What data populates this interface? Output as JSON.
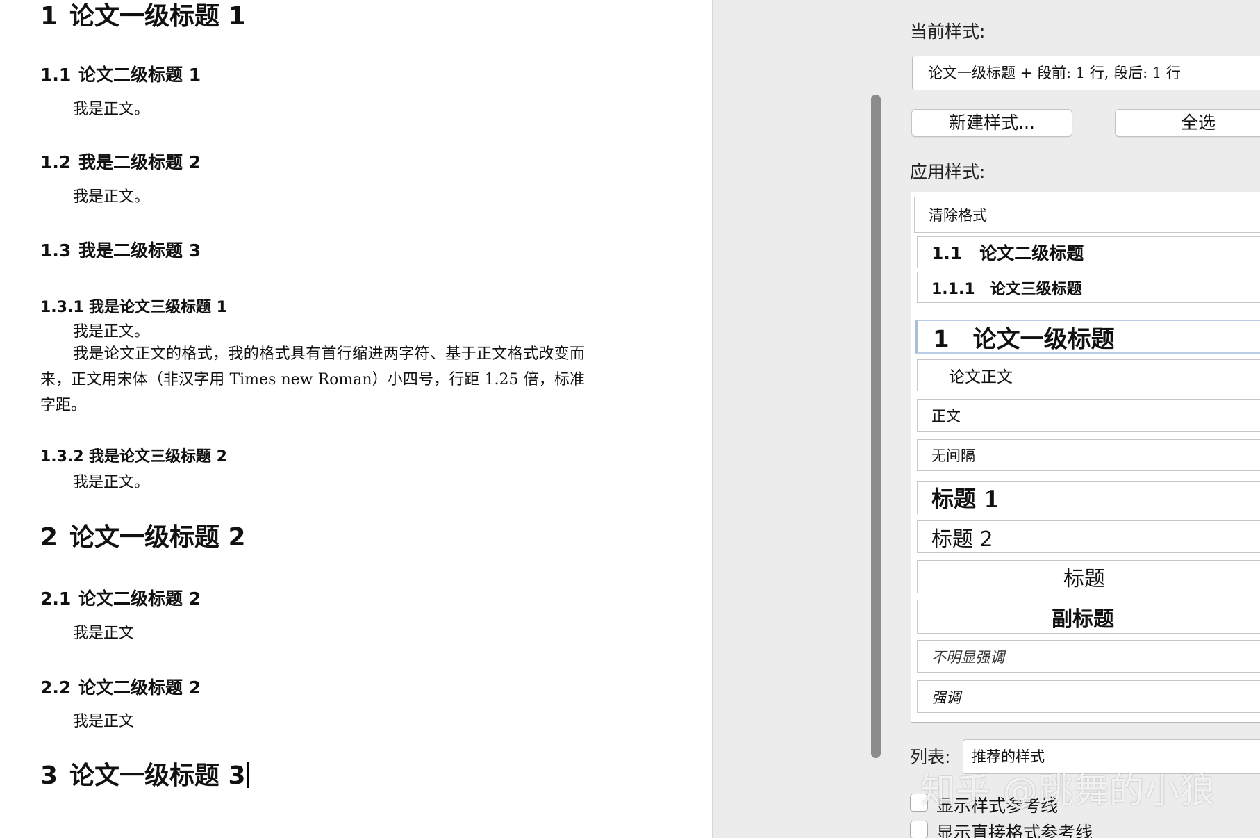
{
  "document": {
    "lines": [
      {
        "num": "1",
        "text": "论文一级标题 1"
      },
      {
        "num": "1.1",
        "text": "论文二级标题 1"
      },
      {
        "text": "我是正文。"
      },
      {
        "num": "1.2",
        "text": "我是二级标题 2"
      },
      {
        "text": "我是正文。"
      },
      {
        "num": "1.3",
        "text": "我是二级标题 3"
      },
      {
        "num": "1.3.1",
        "text": "我是论文三级标题 1"
      },
      {
        "text": "我是正文。"
      },
      {
        "text": "我是论文正文的格式，我的格式具有首行缩进两字符、基于正文格式改变而来，正文用宋体（非汉字用 Times new Roman）小四号，行距 1.25 倍，标准字距。"
      },
      {
        "num": "1.3.2",
        "text": "我是论文三级标题 2"
      },
      {
        "text": "我是正文。"
      },
      {
        "num": "2",
        "text": "论文一级标题 2"
      },
      {
        "num": "2.1",
        "text": "论文二级标题 2"
      },
      {
        "text": "我是正文"
      },
      {
        "num": "2.2",
        "text": "论文二级标题 2"
      },
      {
        "text": "我是正文"
      },
      {
        "num": "3",
        "text": "论文一级标题 3"
      }
    ]
  },
  "styles_pane": {
    "current_style_label": "当前样式:",
    "current_style_value": "论文一级标题 + 段前: 1 行, 段后: 1 行",
    "new_style_button": "新建样式...",
    "select_all_button": "全选",
    "apply_style_label": "应用样式:",
    "styles": [
      "清除格式",
      "1.1　论文二级标题",
      "1.1.1　论文三级标题",
      "1　论文一级标题",
      "论文正文",
      "正文",
      "无间隔",
      "标题 1",
      "标题 2",
      "标题",
      "副标题",
      "不明显强调",
      "强调"
    ],
    "list_label": "列表:",
    "list_value": "推荐的样式",
    "show_style_guides": "显示样式参考线",
    "show_direct_format_guides": "显示直接格式参考线"
  },
  "watermark": "知乎 @跳舞的小狼",
  "colors": {
    "pane_background": "#ececec",
    "scrollbar": "#8c8c8c",
    "selected_style_border": "#b9cde6",
    "arrow_accent": "#2f7bd9"
  }
}
